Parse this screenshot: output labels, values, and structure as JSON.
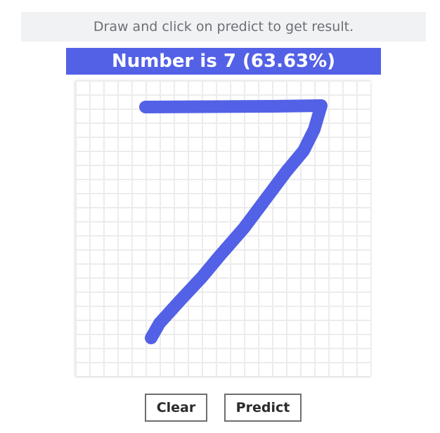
{
  "instruction": "Draw and click on predict to get result.",
  "result": {
    "label": "Number is 7 (63.63%)",
    "predicted_digit": 7,
    "confidence_percent": 63.63
  },
  "canvas": {
    "stroke_color": "#5361e6",
    "grid_color": "#ececec"
  },
  "buttons": {
    "clear_label": "Clear",
    "predict_label": "Predict"
  },
  "colors": {
    "accent": "#5361e6",
    "instruction_bg": "#f1f2f4"
  }
}
